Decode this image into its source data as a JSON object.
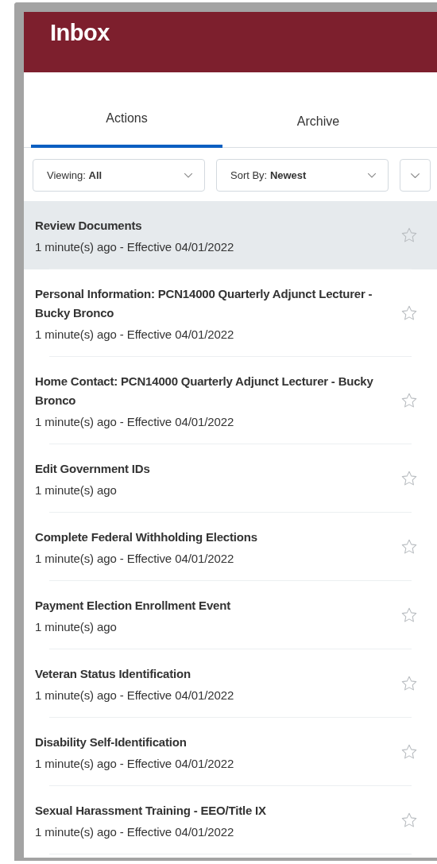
{
  "header": {
    "title": "Inbox"
  },
  "tabs": [
    {
      "label": "Actions",
      "selected": true
    },
    {
      "label": "Archive",
      "selected": false
    }
  ],
  "filters": [
    {
      "label": "Viewing:",
      "value": "All"
    },
    {
      "label": "Sort By:",
      "value": "Newest"
    }
  ],
  "items": [
    {
      "title": "Review Documents",
      "subtitle": "1 minute(s) ago - Effective 04/01/2022",
      "selected": true
    },
    {
      "title": "Personal Information: PCN14000 Quarterly Adjunct Lecturer - Bucky Bronco",
      "subtitle": "1 minute(s) ago - Effective 04/01/2022",
      "selected": false
    },
    {
      "title": "Home Contact: PCN14000 Quarterly Adjunct Lecturer - Bucky Bronco",
      "subtitle": "1 minute(s) ago - Effective 04/01/2022",
      "selected": false
    },
    {
      "title": "Edit Government IDs",
      "subtitle": "1 minute(s) ago",
      "selected": false
    },
    {
      "title": "Complete Federal Withholding Elections",
      "subtitle": "1 minute(s) ago - Effective 04/01/2022",
      "selected": false
    },
    {
      "title": "Payment Election Enrollment Event",
      "subtitle": "1 minute(s) ago",
      "selected": false
    },
    {
      "title": "Veteran Status Identification",
      "subtitle": "1 minute(s) ago - Effective 04/01/2022",
      "selected": false
    },
    {
      "title": "Disability Self-Identification",
      "subtitle": "1 minute(s) ago - Effective 04/01/2022",
      "selected": false
    },
    {
      "title": "Sexual Harassment Training - EEO/Title IX",
      "subtitle": "1 minute(s) ago - Effective 04/01/2022",
      "selected": false
    }
  ]
}
